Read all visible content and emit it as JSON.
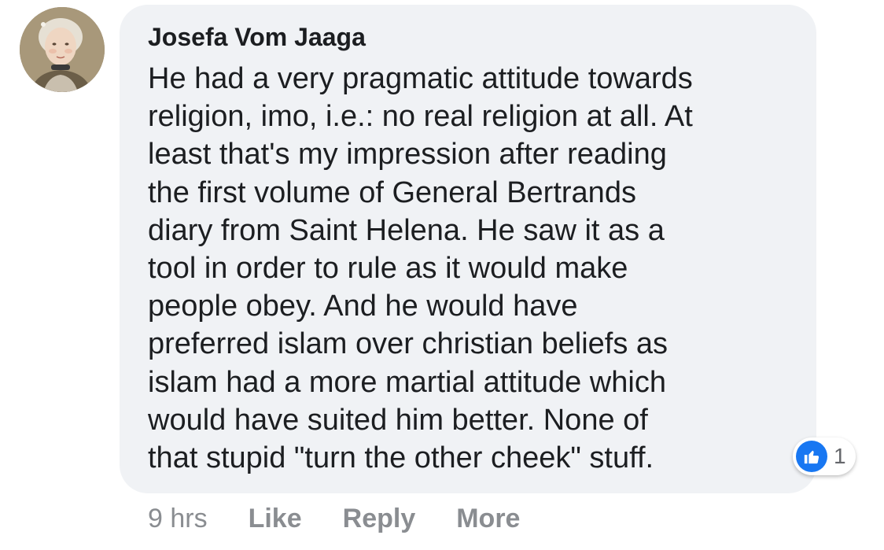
{
  "comment": {
    "author": "Josefa Vom Jaaga",
    "text": "He had a very pragmatic attitude towards\nreligion, imo, i.e.: no real religion at all. At\nleast that's my impression after reading\nthe first volume of General Bertrands\ndiary from Saint Helena. He saw it as a\ntool in order to rule as it would make\npeople obey. And he would have\npreferred islam over christian beliefs as\nislam had a more martial attitude which\nwould have suited him better. None of\nthat stupid \"turn the other cheek\" stuff.",
    "reaction": {
      "icon": "thumbs-up-icon",
      "count": "1",
      "color": "#1877f2"
    },
    "time": "9 hrs",
    "actions": {
      "like": "Like",
      "reply": "Reply",
      "more": "More"
    }
  },
  "colors": {
    "bubble": "#f0f2f5",
    "text": "#1c1e21",
    "meta": "#8a8d91"
  }
}
